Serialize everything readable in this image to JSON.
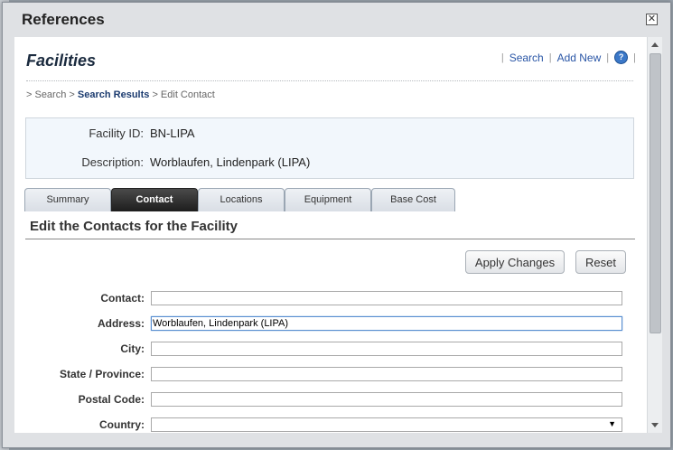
{
  "dialog": {
    "title": "References",
    "close_glyph": "✕"
  },
  "page": {
    "heading": "Facilities",
    "links": {
      "sep": "|",
      "search": "Search",
      "add_new": "Add New",
      "help_glyph": "?"
    }
  },
  "breadcrumb": {
    "prefix1": "> Search >",
    "current": "Search Results",
    "suffix": "> Edit Contact"
  },
  "facility": {
    "id_label": "Facility ID:",
    "id_value": "BN-LIPA",
    "desc_label": "Description:",
    "desc_value": "Worblaufen, Lindenpark (LIPA)"
  },
  "tabs": [
    {
      "label": "Summary"
    },
    {
      "label": "Contact",
      "active": true
    },
    {
      "label": "Locations"
    },
    {
      "label": "Equipment"
    },
    {
      "label": "Base Cost"
    }
  ],
  "section": {
    "title": "Edit the Contacts for the Facility"
  },
  "buttons": {
    "apply": "Apply Changes",
    "reset": "Reset"
  },
  "form": {
    "contact": {
      "label": "Contact:",
      "value": ""
    },
    "address": {
      "label": "Address:",
      "value": "Worblaufen, Lindenpark (LIPA)"
    },
    "city": {
      "label": "City:",
      "value": ""
    },
    "state": {
      "label": "State / Province:",
      "value": ""
    },
    "postal": {
      "label": "Postal Code:",
      "value": ""
    },
    "country": {
      "label": "Country:",
      "value": "",
      "caret": "▼"
    }
  }
}
